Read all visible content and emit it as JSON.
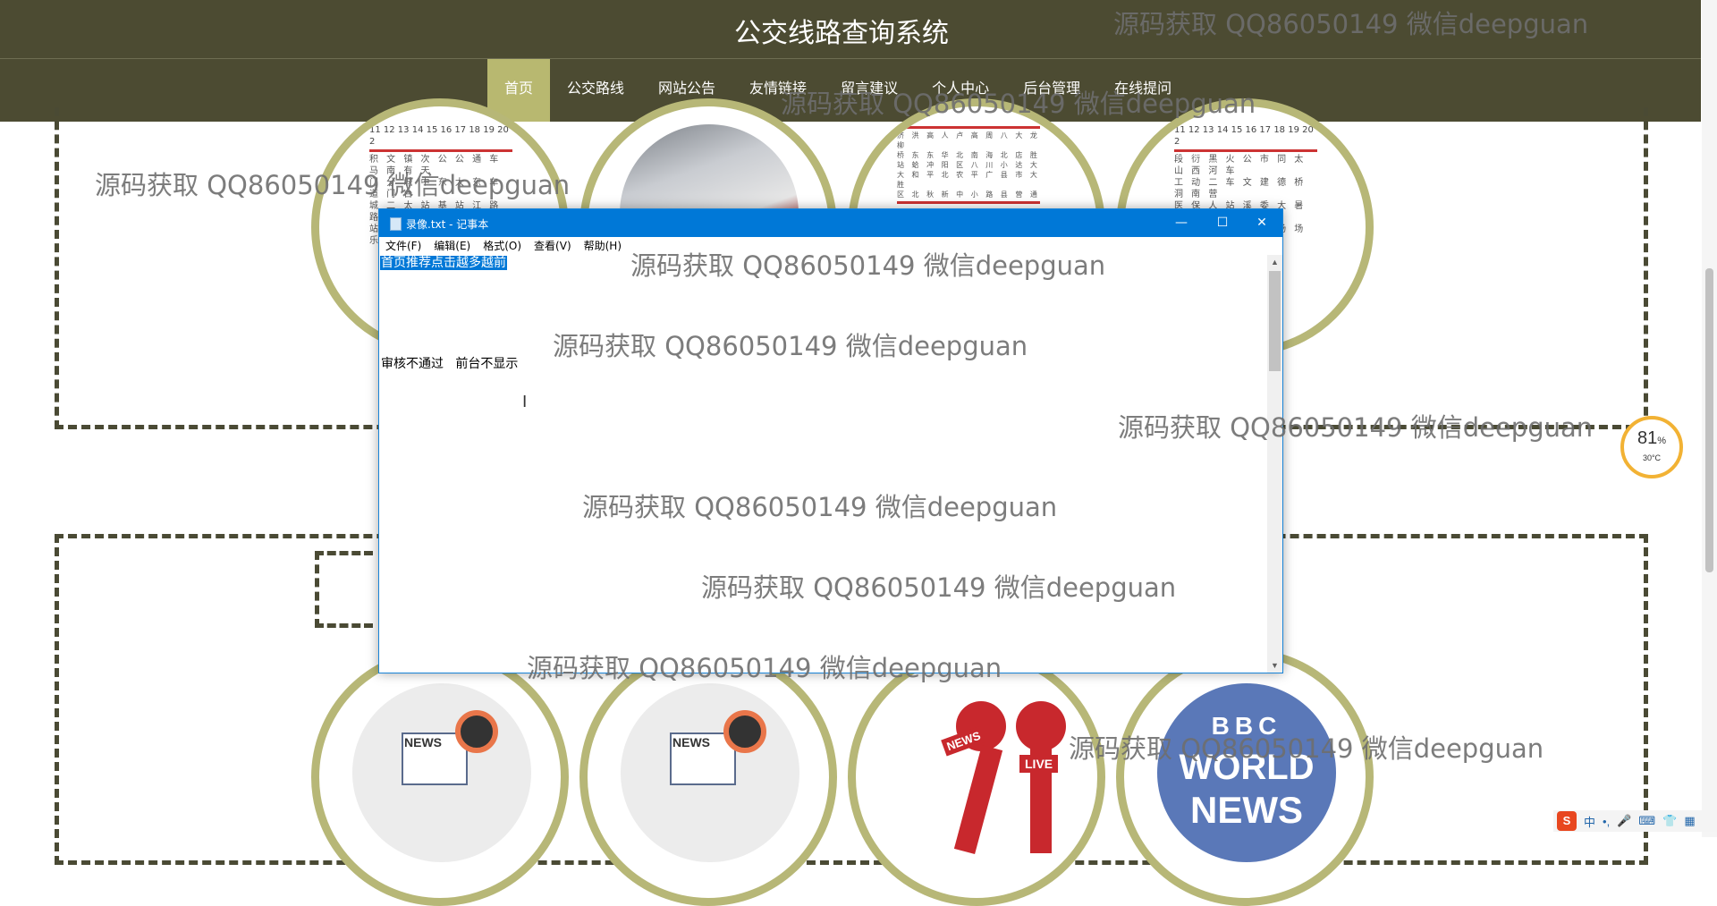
{
  "site": {
    "title": "公交线路查询系统"
  },
  "nav": {
    "items": [
      {
        "label": "首页",
        "active": true
      },
      {
        "label": "公交路线"
      },
      {
        "label": "网站公告"
      },
      {
        "label": "友情链接"
      },
      {
        "label": "留言建议"
      },
      {
        "label": "个人中心"
      },
      {
        "label": "后台管理"
      },
      {
        "label": "在线提问"
      }
    ]
  },
  "notepad": {
    "title": "录像.txt - 记事本",
    "menu": [
      "文件(F)",
      "编辑(E)",
      "格式(O)",
      "查看(V)",
      "帮助(H)"
    ],
    "selected_line": "首页推荐点击越多越前",
    "line2": "审核不通过   前台不显示",
    "controls": {
      "minimize": "—",
      "maximize": "☐",
      "close": "✕"
    }
  },
  "cards_top": [
    {
      "image": "bus-timetable-image",
      "header": "11 12 13 14 15 16 17 18 19 20 2"
    },
    {
      "image": "train-photo"
    },
    {
      "image": "bus-timetable-image"
    },
    {
      "image": "bus-timetable-image",
      "header": "11 12 13 14 15 16 17 18 19 20 2"
    }
  ],
  "cards_bottom": [
    {
      "image": "news-illustration",
      "text": "NEWS"
    },
    {
      "image": "news-illustration",
      "text": "NEWS"
    },
    {
      "image": "news-live-microphone",
      "text": "NEWS",
      "live": "LIVE"
    },
    {
      "image": "bbc-world-news-logo",
      "bbc": "BBC",
      "line1": "WORLD",
      "line2": "NEWS"
    }
  ],
  "watermark": "源码获取 QQ86050149 微信deepguan",
  "gauge": {
    "value": "81",
    "unit": "%",
    "temp": "30°C"
  },
  "tray": {
    "input_mode": "中",
    "punct": "•,"
  },
  "colors": {
    "header_bg": "#4c4b32",
    "nav_active": "#b8b870",
    "circle_border": "#b7b777",
    "notepad_title": "#0078d7"
  }
}
